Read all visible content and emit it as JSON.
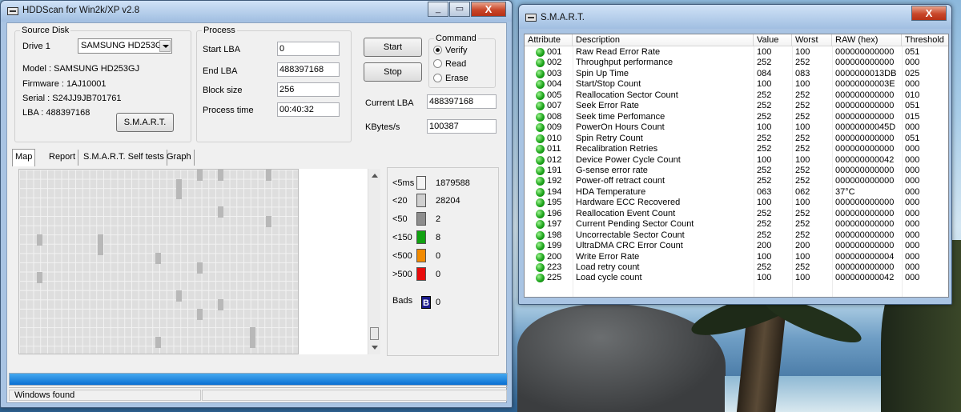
{
  "main_window": {
    "title": "HDDScan for Win2k/XP  v2.8",
    "controls": {
      "minimize": "_",
      "maximize": "▭",
      "close": "X"
    },
    "source_disk": {
      "legend": "Source Disk",
      "drive_label": "Drive 1",
      "drive_selected": "SAMSUNG HD253G",
      "model": "Model : SAMSUNG HD253GJ",
      "firmware": "Firmware : 1AJ10001",
      "serial": "Serial : S24JJ9JB701761",
      "lba": "LBA :  488397168",
      "smart_button": "S.M.A.R.T."
    },
    "process": {
      "legend": "Process",
      "start_lba_label": "Start LBA",
      "start_lba": "0",
      "end_lba_label": "End LBA",
      "end_lba": "488397168",
      "block_size_label": "Block size",
      "block_size": "256",
      "process_time_label": "Process time",
      "process_time": "00:40:32",
      "start_button": "Start",
      "stop_button": "Stop",
      "current_lba_label": "Current LBA",
      "current_lba": "488397168",
      "kbytes_label": "KBytes/s",
      "kbytes": "100387"
    },
    "command": {
      "legend": "Command",
      "options": [
        "Verify",
        "Read",
        "Erase"
      ],
      "selected": "Verify"
    },
    "tabs": [
      "Map",
      "Report",
      "S.M.A.R.T. Self tests",
      "Graph"
    ],
    "active_tab": "Map",
    "legend_rows": [
      {
        "label": "<5ms",
        "color": "#f4f4f4",
        "count": "1879588"
      },
      {
        "label": "<20",
        "color": "#cfcfcf",
        "count": "28204"
      },
      {
        "label": "<50",
        "color": "#8d8d8d",
        "count": "2"
      },
      {
        "label": "<150",
        "color": "#11a211",
        "count": "8"
      },
      {
        "label": "<500",
        "color": "#f28a00",
        "count": "0"
      },
      {
        "label": ">500",
        "color": "#e80b0b",
        "count": "0"
      }
    ],
    "bads": {
      "label": "Bads",
      "mark": "B",
      "count": "0"
    },
    "progress_fraction": 1.0,
    "status_text": "Windows  found"
  },
  "smart_window": {
    "title": "S.M.A.R.T.",
    "controls": {
      "close": "X"
    },
    "columns": [
      "Attribute",
      "Description",
      "Value",
      "Worst",
      "RAW (hex)",
      "Threshold"
    ],
    "rows": [
      [
        "001",
        "Raw Read Error Rate",
        "100",
        "100",
        "000000000000",
        "051"
      ],
      [
        "002",
        "Throughput performance",
        "252",
        "252",
        "000000000000",
        "000"
      ],
      [
        "003",
        "Spin Up Time",
        "084",
        "083",
        "0000000013DB",
        "025"
      ],
      [
        "004",
        "Start/Stop Count",
        "100",
        "100",
        "00000000003E",
        "000"
      ],
      [
        "005",
        "Reallocation Sector Count",
        "252",
        "252",
        "000000000000",
        "010"
      ],
      [
        "007",
        "Seek Error Rate",
        "252",
        "252",
        "000000000000",
        "051"
      ],
      [
        "008",
        "Seek time Perfomance",
        "252",
        "252",
        "000000000000",
        "015"
      ],
      [
        "009",
        "PowerOn Hours Count",
        "100",
        "100",
        "00000000045D",
        "000"
      ],
      [
        "010",
        "Spin Retry Count",
        "252",
        "252",
        "000000000000",
        "051"
      ],
      [
        "011",
        "Recalibration Retries",
        "252",
        "252",
        "000000000000",
        "000"
      ],
      [
        "012",
        "Device Power Cycle Count",
        "100",
        "100",
        "000000000042",
        "000"
      ],
      [
        "191",
        "G-sense error rate",
        "252",
        "252",
        "000000000000",
        "000"
      ],
      [
        "192",
        "Power-off retract count",
        "252",
        "252",
        "000000000000",
        "000"
      ],
      [
        "194",
        "HDA Temperature",
        "063",
        "062",
        "37°C",
        "000"
      ],
      [
        "195",
        "Hardware ECC Recovered",
        "100",
        "100",
        "000000000000",
        "000"
      ],
      [
        "196",
        "Reallocation Event Count",
        "252",
        "252",
        "000000000000",
        "000"
      ],
      [
        "197",
        "Current Pending Sector Count",
        "252",
        "252",
        "000000000000",
        "000"
      ],
      [
        "198",
        "Uncorrectable Sector Count",
        "252",
        "252",
        "000000000000",
        "000"
      ],
      [
        "199",
        "UltraDMA CRC Error Count",
        "200",
        "200",
        "000000000000",
        "000"
      ],
      [
        "200",
        "Write Error Rate",
        "100",
        "100",
        "000000000004",
        "000"
      ],
      [
        "223",
        "Load retry count",
        "252",
        "252",
        "000000000000",
        "000"
      ],
      [
        "225",
        "Load cycle count",
        "100",
        "100",
        "000000000042",
        "000"
      ]
    ]
  }
}
